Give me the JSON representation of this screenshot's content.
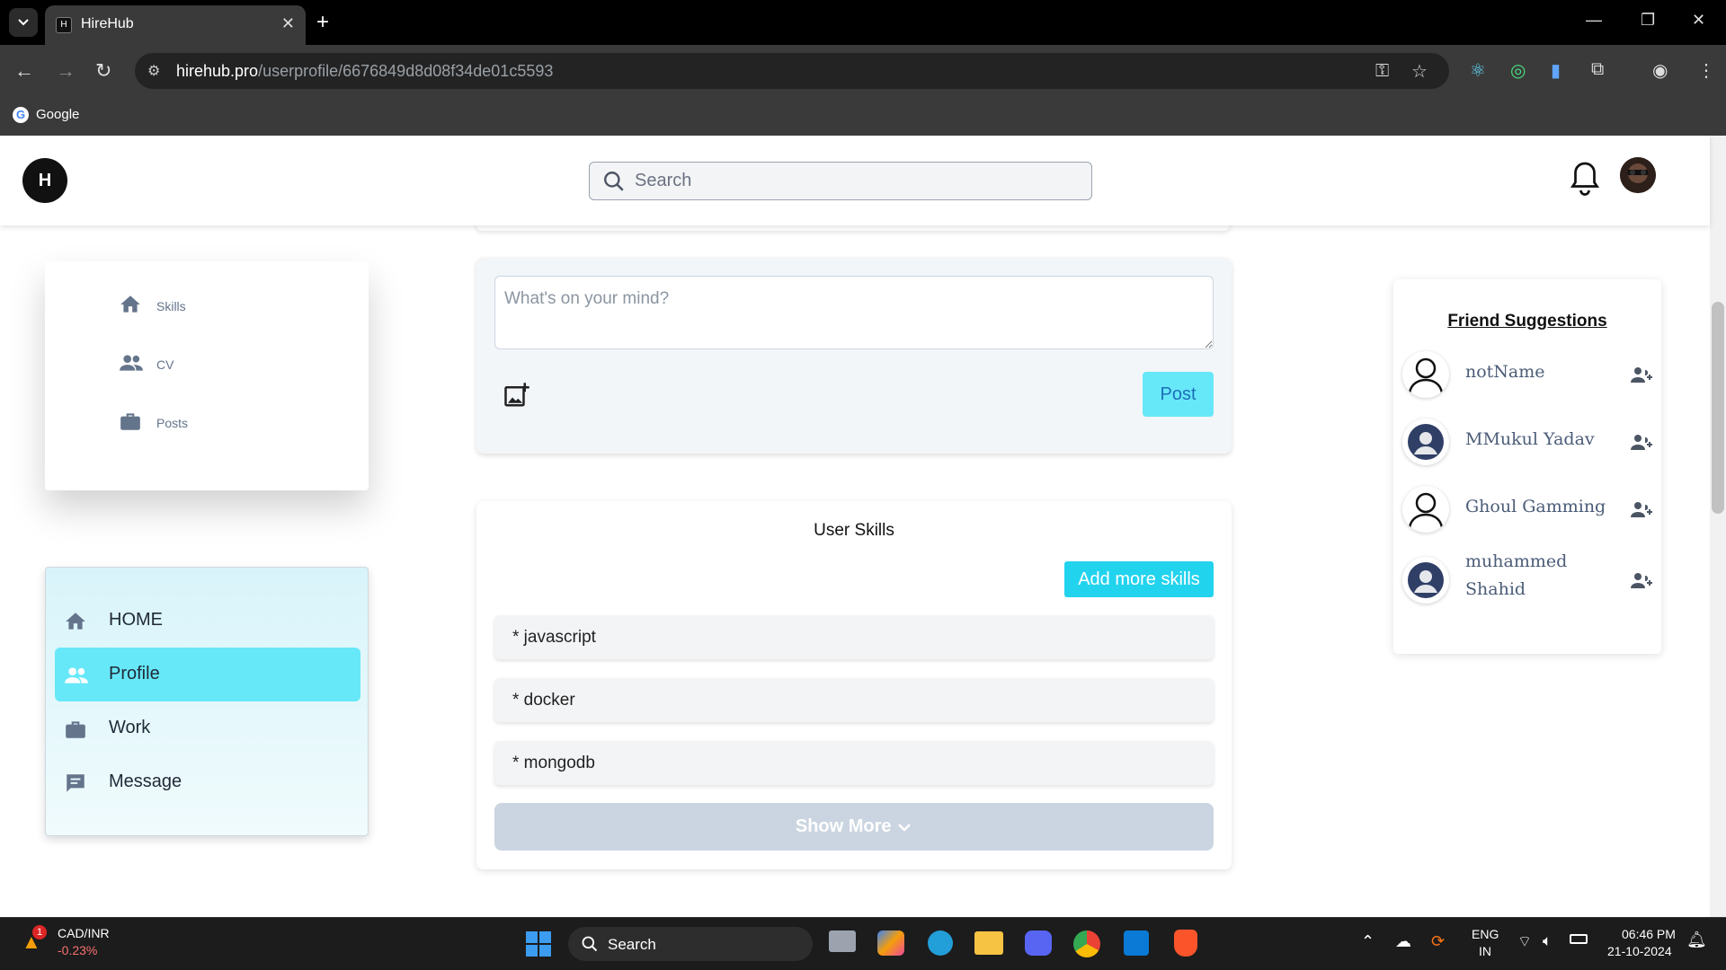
{
  "browser": {
    "tab_title": "HireHub",
    "tab_favicon": "H",
    "url_host": "hirehub.pro",
    "url_path": "/userprofile/6676849d8d08f34de01c5593",
    "bookmark_google": "Google"
  },
  "header": {
    "logo": "H",
    "search_placeholder": "Search"
  },
  "left_card": {
    "items": [
      {
        "label": "Skills",
        "icon": "home-icon"
      },
      {
        "label": "CV",
        "icon": "people-icon"
      },
      {
        "label": "Posts",
        "icon": "briefcase-icon"
      }
    ]
  },
  "sidenav": {
    "items": [
      {
        "label": "HOME",
        "icon": "home-icon",
        "active": false
      },
      {
        "label": "Profile",
        "icon": "people-icon",
        "active": true
      },
      {
        "label": "Work",
        "icon": "briefcase-icon",
        "active": false
      },
      {
        "label": "Message",
        "icon": "message-icon",
        "active": false
      }
    ]
  },
  "post": {
    "placeholder": "What's on your mind?",
    "button": "Post"
  },
  "skills": {
    "title": "User Skills",
    "add_button": "Add more skills",
    "items": [
      "* javascript",
      "* docker",
      "* mongodb"
    ],
    "show_more": "Show More"
  },
  "friends": {
    "title": "Friend Suggestions",
    "items": [
      {
        "name": "notName",
        "avatar": "outline-user-icon"
      },
      {
        "name": "MMukul Yadav",
        "avatar": "default-avatar"
      },
      {
        "name": "Ghoul Gamming",
        "avatar": "outline-user-icon"
      },
      {
        "name": "muhammed Shahid",
        "avatar": "default-avatar"
      }
    ]
  },
  "taskbar": {
    "ticker_badge": "1",
    "ticker_name": "CAD/INR",
    "ticker_change": "-0.23%",
    "search": "Search",
    "lang_top": "ENG",
    "lang_bottom": "IN",
    "time": "06:46 PM",
    "date": "21-10-2024"
  },
  "colors": {
    "accent": "#67e8f9",
    "add_skills": "#22d3ee",
    "show_more": "#cbd5e1"
  }
}
